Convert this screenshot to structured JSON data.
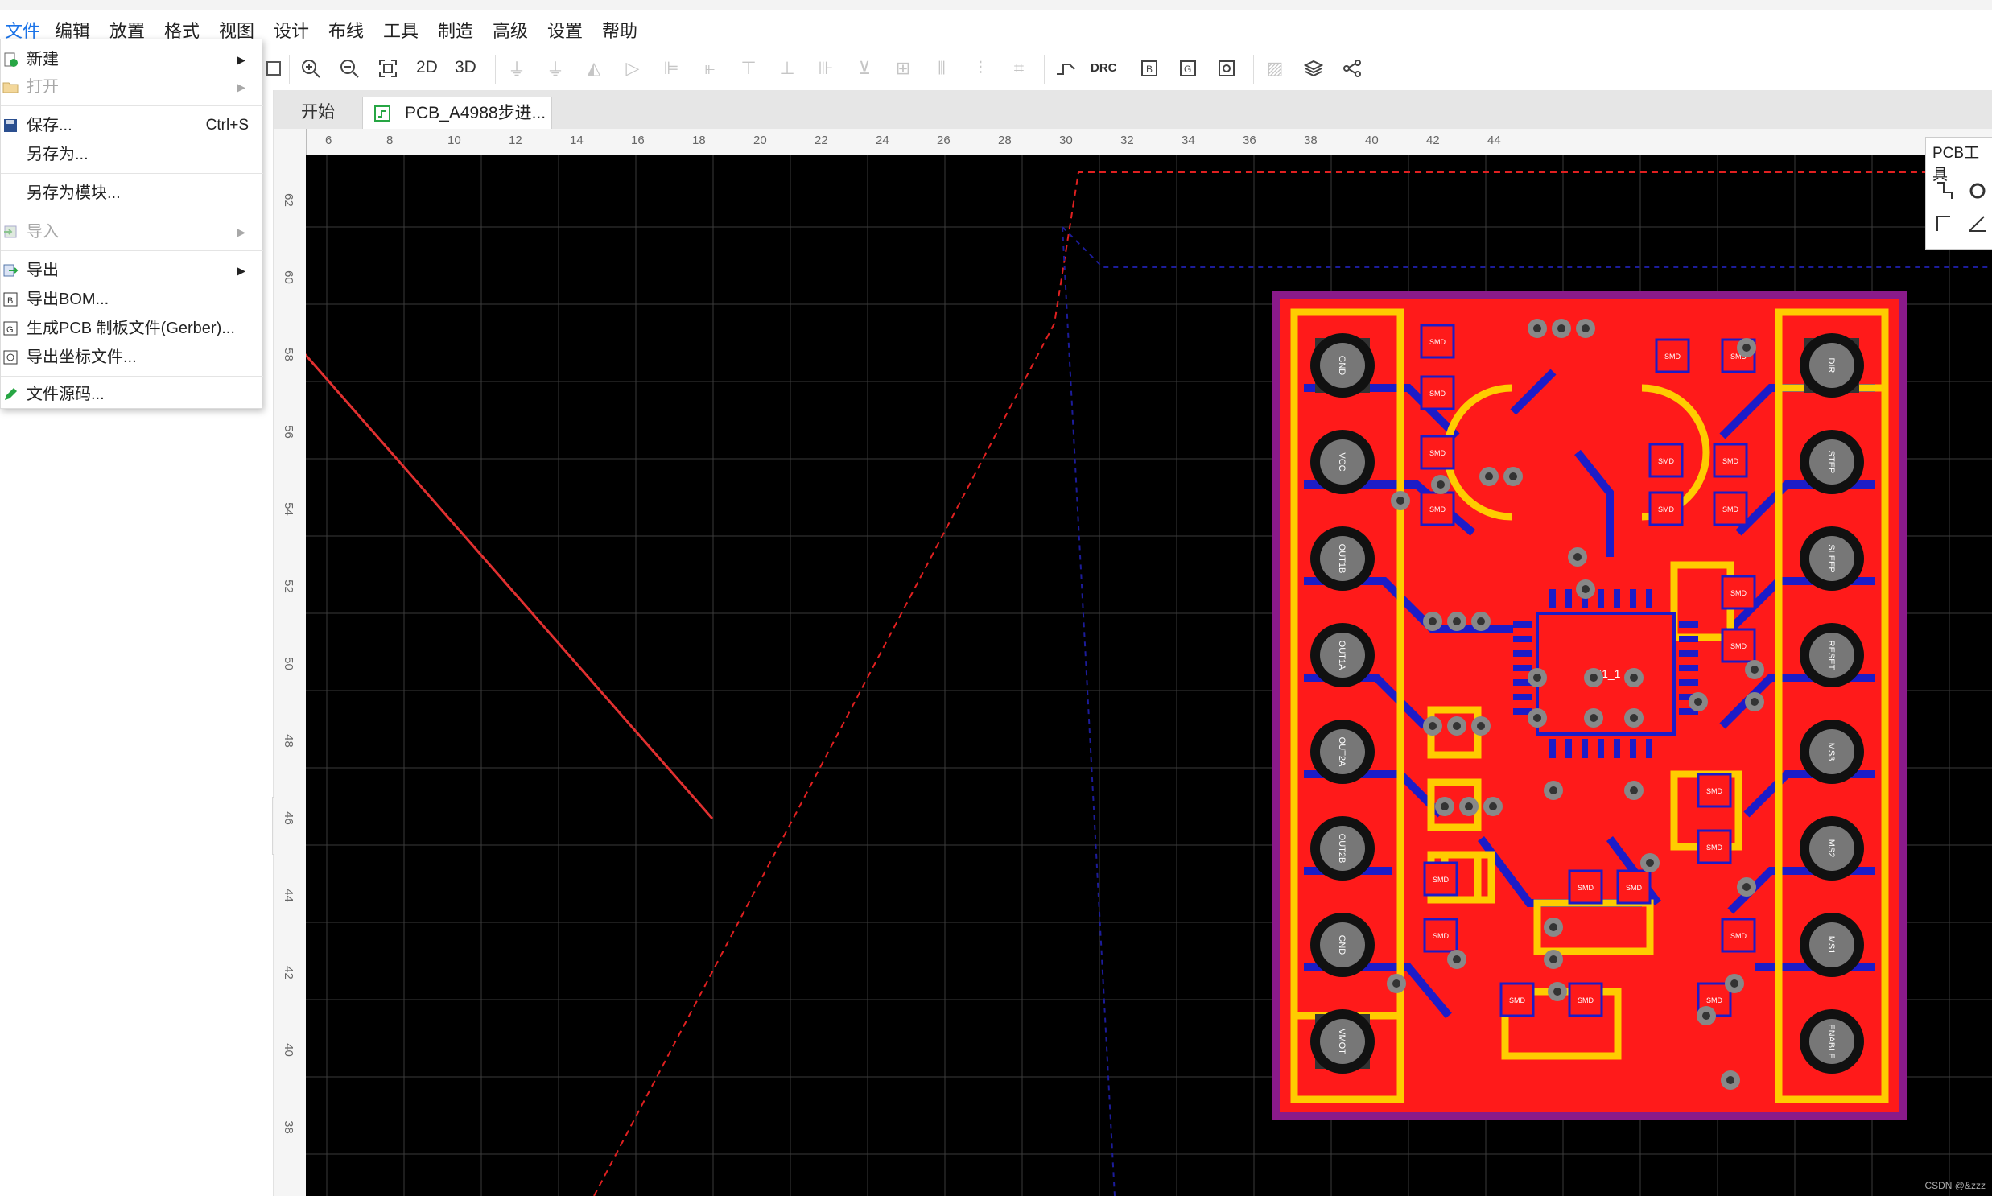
{
  "menubar": {
    "items": [
      "文件",
      "编辑",
      "放置",
      "格式",
      "视图",
      "设计",
      "布线",
      "工具",
      "制造",
      "高级",
      "设置",
      "帮助"
    ]
  },
  "file_menu": {
    "new": "新建",
    "open": "打开",
    "save": "保存...",
    "save_shortcut": "Ctrl+S",
    "save_as": "另存为...",
    "save_as_module": "另存为模块...",
    "import": "导入",
    "export": "导出",
    "export_bom": "导出BOM...",
    "gerber": "生成PCB 制板文件(Gerber)...",
    "export_coords": "导出坐标文件...",
    "source": "文件源码..."
  },
  "toolbar": {
    "view_2d": "2D",
    "view_3d": "3D",
    "drc": "DRC",
    "icons": [
      "zoom-in-icon",
      "zoom-out-icon",
      "fit-icon",
      "layers-icon",
      "share-icon"
    ]
  },
  "tabs": {
    "start": "开始",
    "pcb": "PCB_A4988步进..."
  },
  "ruler": {
    "h_labels": [
      "6",
      "8",
      "10",
      "12",
      "14",
      "16",
      "18",
      "20",
      "22",
      "24",
      "26",
      "28",
      "30",
      "32",
      "34",
      "36",
      "38",
      "40",
      "42",
      "44"
    ],
    "v_labels": [
      "62",
      "60",
      "58",
      "56",
      "54",
      "52",
      "50",
      "48",
      "46",
      "44",
      "42",
      "40",
      "38"
    ]
  },
  "pcb_tools": {
    "title": "PCB工具"
  },
  "board": {
    "left_pins": [
      "GND",
      "VCC",
      "OUT1B",
      "OUT1A",
      "OUT2A",
      "OUT2B",
      "GND",
      "VMOT"
    ],
    "right_pins": [
      "DIR",
      "STEP",
      "SLEEP",
      "RESET",
      "MS3",
      "MS2",
      "MS1",
      "ENABLE"
    ],
    "chip": "U1_1",
    "smd_label": "SMD"
  },
  "colors": {
    "canvas": "#000000",
    "copper_top": "#ff1a1a",
    "copper_bottom": "#1c1cc8",
    "silkscreen": "#ffcc00",
    "outline": "#8a1a8a",
    "grid": "#3a3a3a",
    "arrow": "#e03030"
  },
  "watermark": "CSDN @&zzz"
}
